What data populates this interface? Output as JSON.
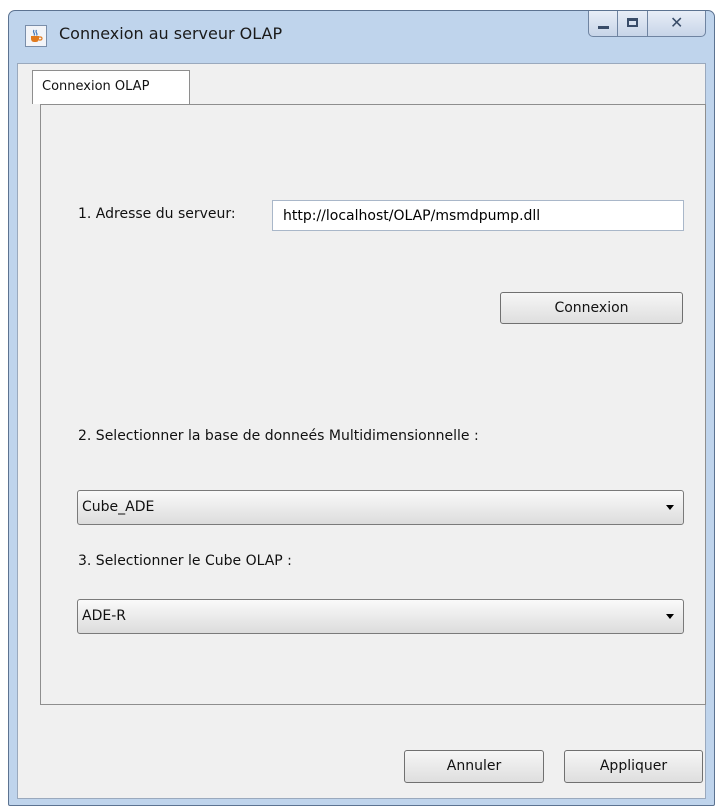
{
  "window": {
    "title": "Connexion au serveur OLAP",
    "controls": {
      "minimize": "minimize",
      "maximize": "maximize",
      "close": "close"
    }
  },
  "tabs": [
    {
      "label": "Connexion OLAP",
      "selected": true
    }
  ],
  "server": {
    "label": "1. Adresse du serveur:",
    "value": "http://localhost/OLAP/msmdpump.dll",
    "connect_label": "Connexion"
  },
  "database": {
    "label": "2. Selectionner la base de donneés Multidimensionnelle :",
    "selected": "Cube_ADE"
  },
  "cube": {
    "label": "3. Selectionner le Cube OLAP :",
    "selected": "ADE-R"
  },
  "footer": {
    "cancel_label": "Annuler",
    "apply_label": "Appliquer"
  },
  "icons": {
    "app": "java-coffee-cup-icon",
    "minimize": "minimize-icon",
    "maximize": "maximize-icon",
    "close": "close-icon",
    "dropdown": "chevron-down-icon"
  }
}
